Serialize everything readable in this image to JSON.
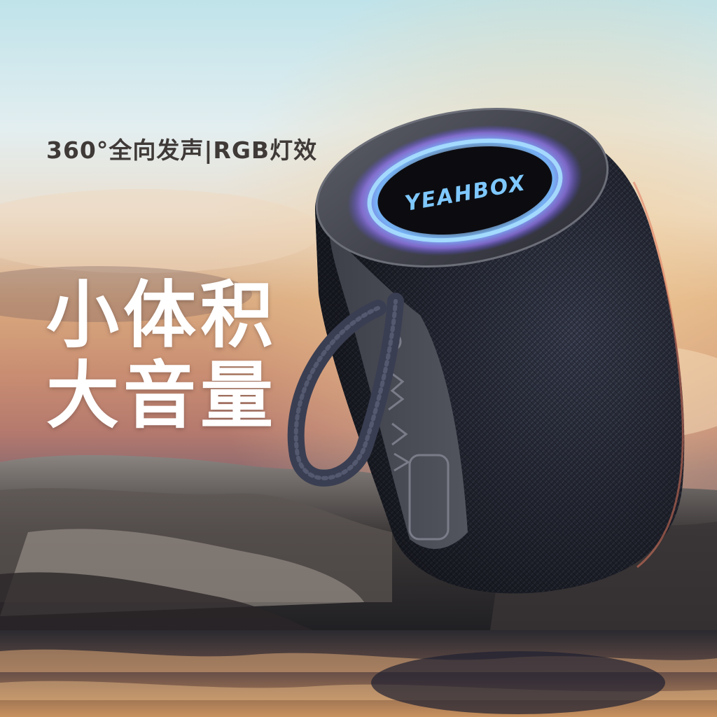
{
  "tagline": "360°全向发声|RGB灯效",
  "headline": {
    "line1": "小体积",
    "line2": "大音量"
  },
  "product": {
    "brand_logo": "YEAHBOX",
    "button_icons": [
      "power-icon",
      "bluetooth-icon",
      "volume-up-icon",
      "volume-down-icon"
    ]
  },
  "colors": {
    "sky_top": "#bfe3ea",
    "sunset": "#d9a078",
    "speaker_body": "#2f3342",
    "light_ring": "#5fb4ff",
    "logo": "#7ec8ff",
    "headline": "#ffffff"
  }
}
